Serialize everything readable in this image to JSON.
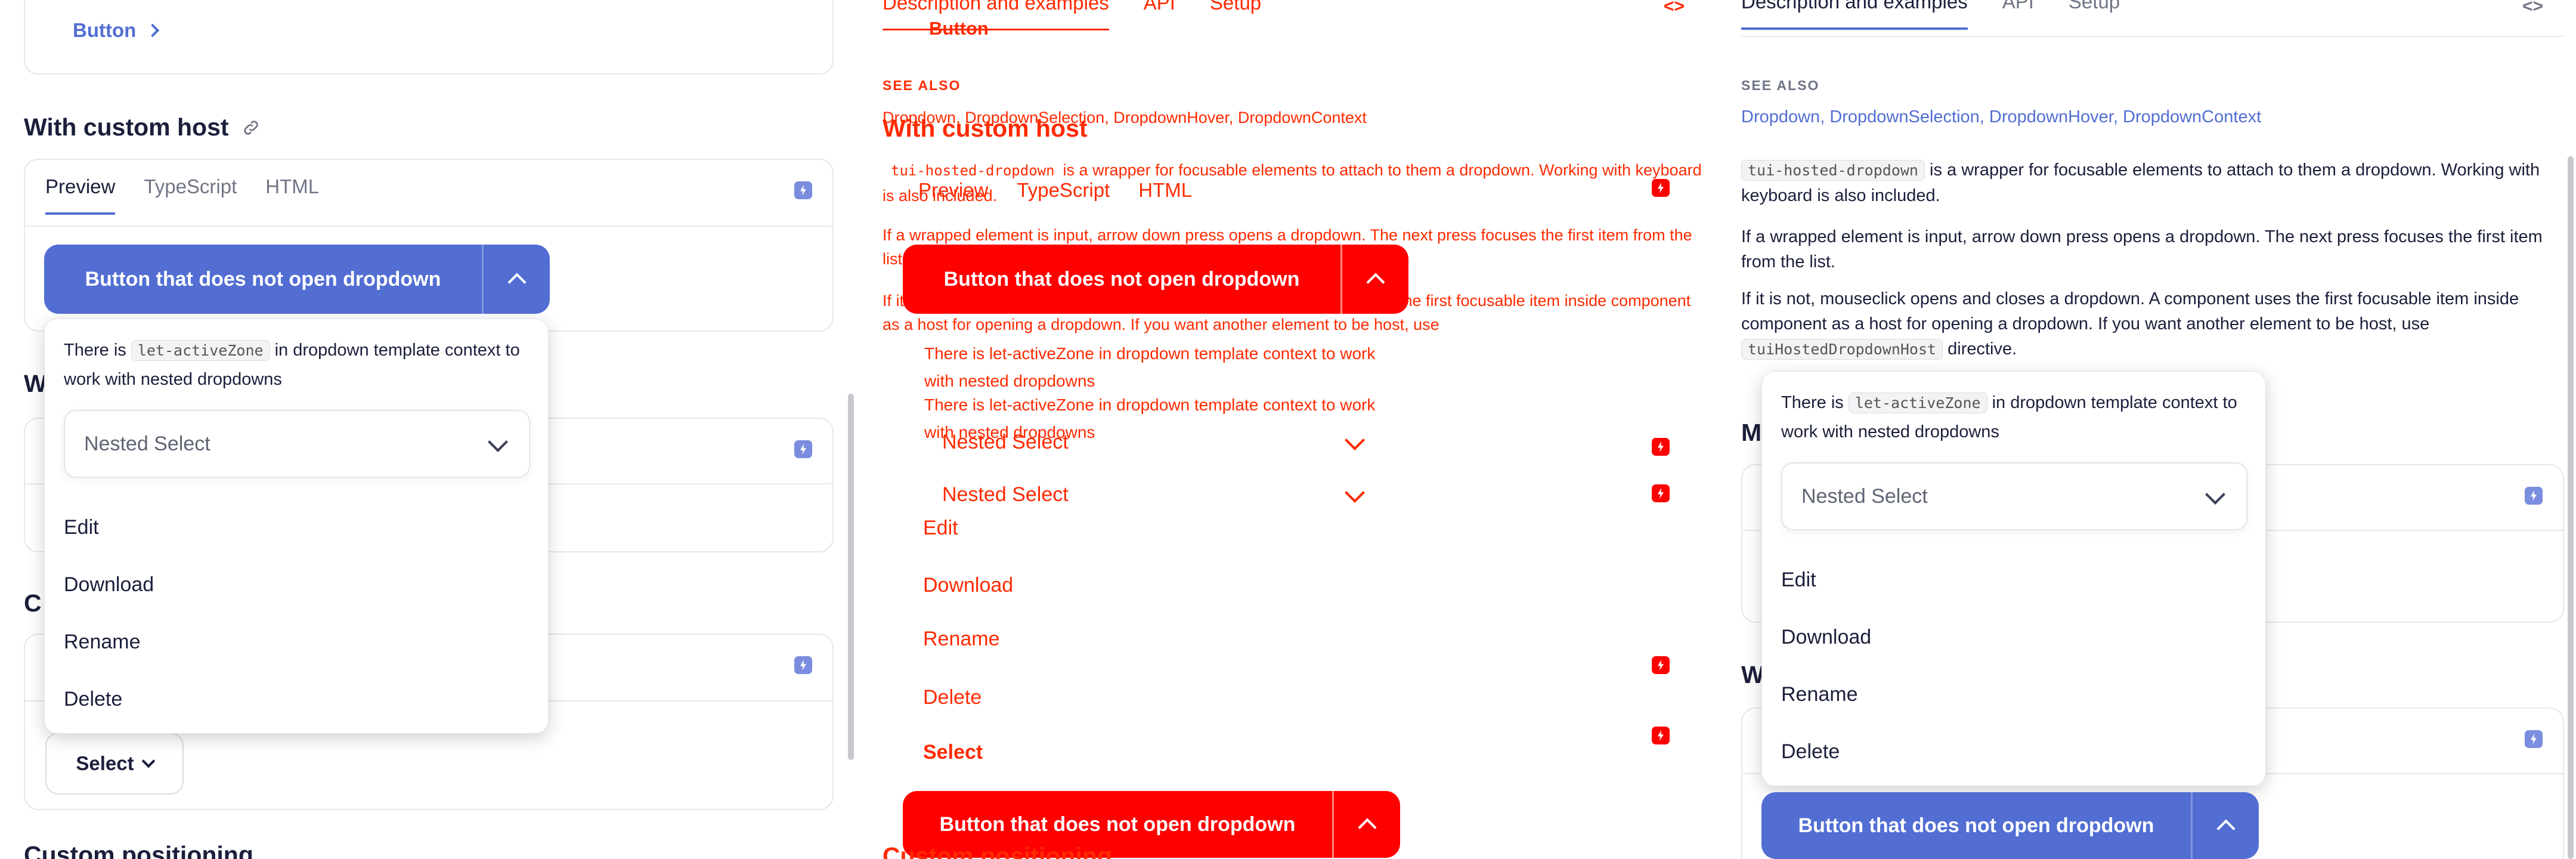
{
  "left": {
    "top_button_label": "Button",
    "section_custom_host": "With custom host",
    "tabs": [
      "Preview",
      "TypeScript",
      "HTML"
    ],
    "main_button_label": "Button that does not open dropdown",
    "dropdown": {
      "text_before": "There is",
      "code": "let-activeZone",
      "text_after": "in dropdown template context to work with nested dropdowns",
      "nested_select_placeholder": "Nested Select",
      "items": [
        "Edit",
        "Download",
        "Rename",
        "Delete"
      ]
    },
    "partial_headings": [
      "W",
      "C"
    ],
    "select_button_label": "Select",
    "bottom_heading": "Custom positioning"
  },
  "right": {
    "tabs": [
      "Description and examples",
      "API",
      "Setup"
    ],
    "see_also_label": "SEE ALSO",
    "see_also_links": [
      "Dropdown",
      "DropdownSelection",
      "DropdownHover",
      "DropdownContext"
    ],
    "para1_code": "tui-hosted-dropdown",
    "para1_text": "is a wrapper for focusable elements to attach to them a dropdown. Working with keyboard is also included.",
    "para2": "If a wrapped element is input, arrow down press opens a dropdown. The next press focuses the first item from the list.",
    "para3": "If it is not, mouseclick opens and closes a dropdown. A component uses the first focusable item inside component as a host for opening a dropdown. If you want another element to be host, use",
    "para3_code": "tuiHostedDropdownHost",
    "para3_end": "directive.",
    "dropdown": {
      "text_before": "There is",
      "code": "let-activeZone",
      "text_after": "in dropdown template context to work with nested dropdowns",
      "nested_select_placeholder": "Nested Select",
      "items": [
        "Edit",
        "Download",
        "Rename",
        "Delete"
      ]
    },
    "partial_headings": [
      "M",
      "W"
    ],
    "main_button_label": "Button that does not open dropdown"
  },
  "diff": {
    "button_label": "Button",
    "section_custom_host": "With custom host",
    "tabs": [
      "Description and examples",
      "API",
      "Setup"
    ],
    "preview_tabs": [
      "Preview",
      "TypeScript",
      "HTML"
    ],
    "see_also_label": "SEE ALSO",
    "see_also_links": "Dropdown, DropdownSelection, DropdownHover, DropdownContext",
    "para1_code": "tui-hosted-dropdown",
    "para1_text": "is a wrapper for focusable elements to attach to them a dropdown. Working with keyboard is also included.",
    "para2": "If a wrapped element is input, arrow down press opens a dropdown. The next press focuses the first item from the list.",
    "para3": "If it is not, mouseclick opens and closes a dropdown. A component uses the first focusable item inside component as a host for opening a dropdown. If you want another element to be host, use",
    "main_button_label": "Button that does not open dropdown",
    "dd_text1": "There is let-activeZone in dropdown template context to work with nested dropdowns",
    "dd_text2": "There is let-activeZone in dropdown template context to work with nested dropdowns",
    "nested_select": "Nested Select",
    "items": [
      "Edit",
      "Download",
      "Rename",
      "Delete"
    ],
    "select_label": "Select",
    "bottom_heading": "Custom positioning"
  },
  "colors": {
    "accent": "#526ed3",
    "diff_red": "#ff2a00"
  }
}
